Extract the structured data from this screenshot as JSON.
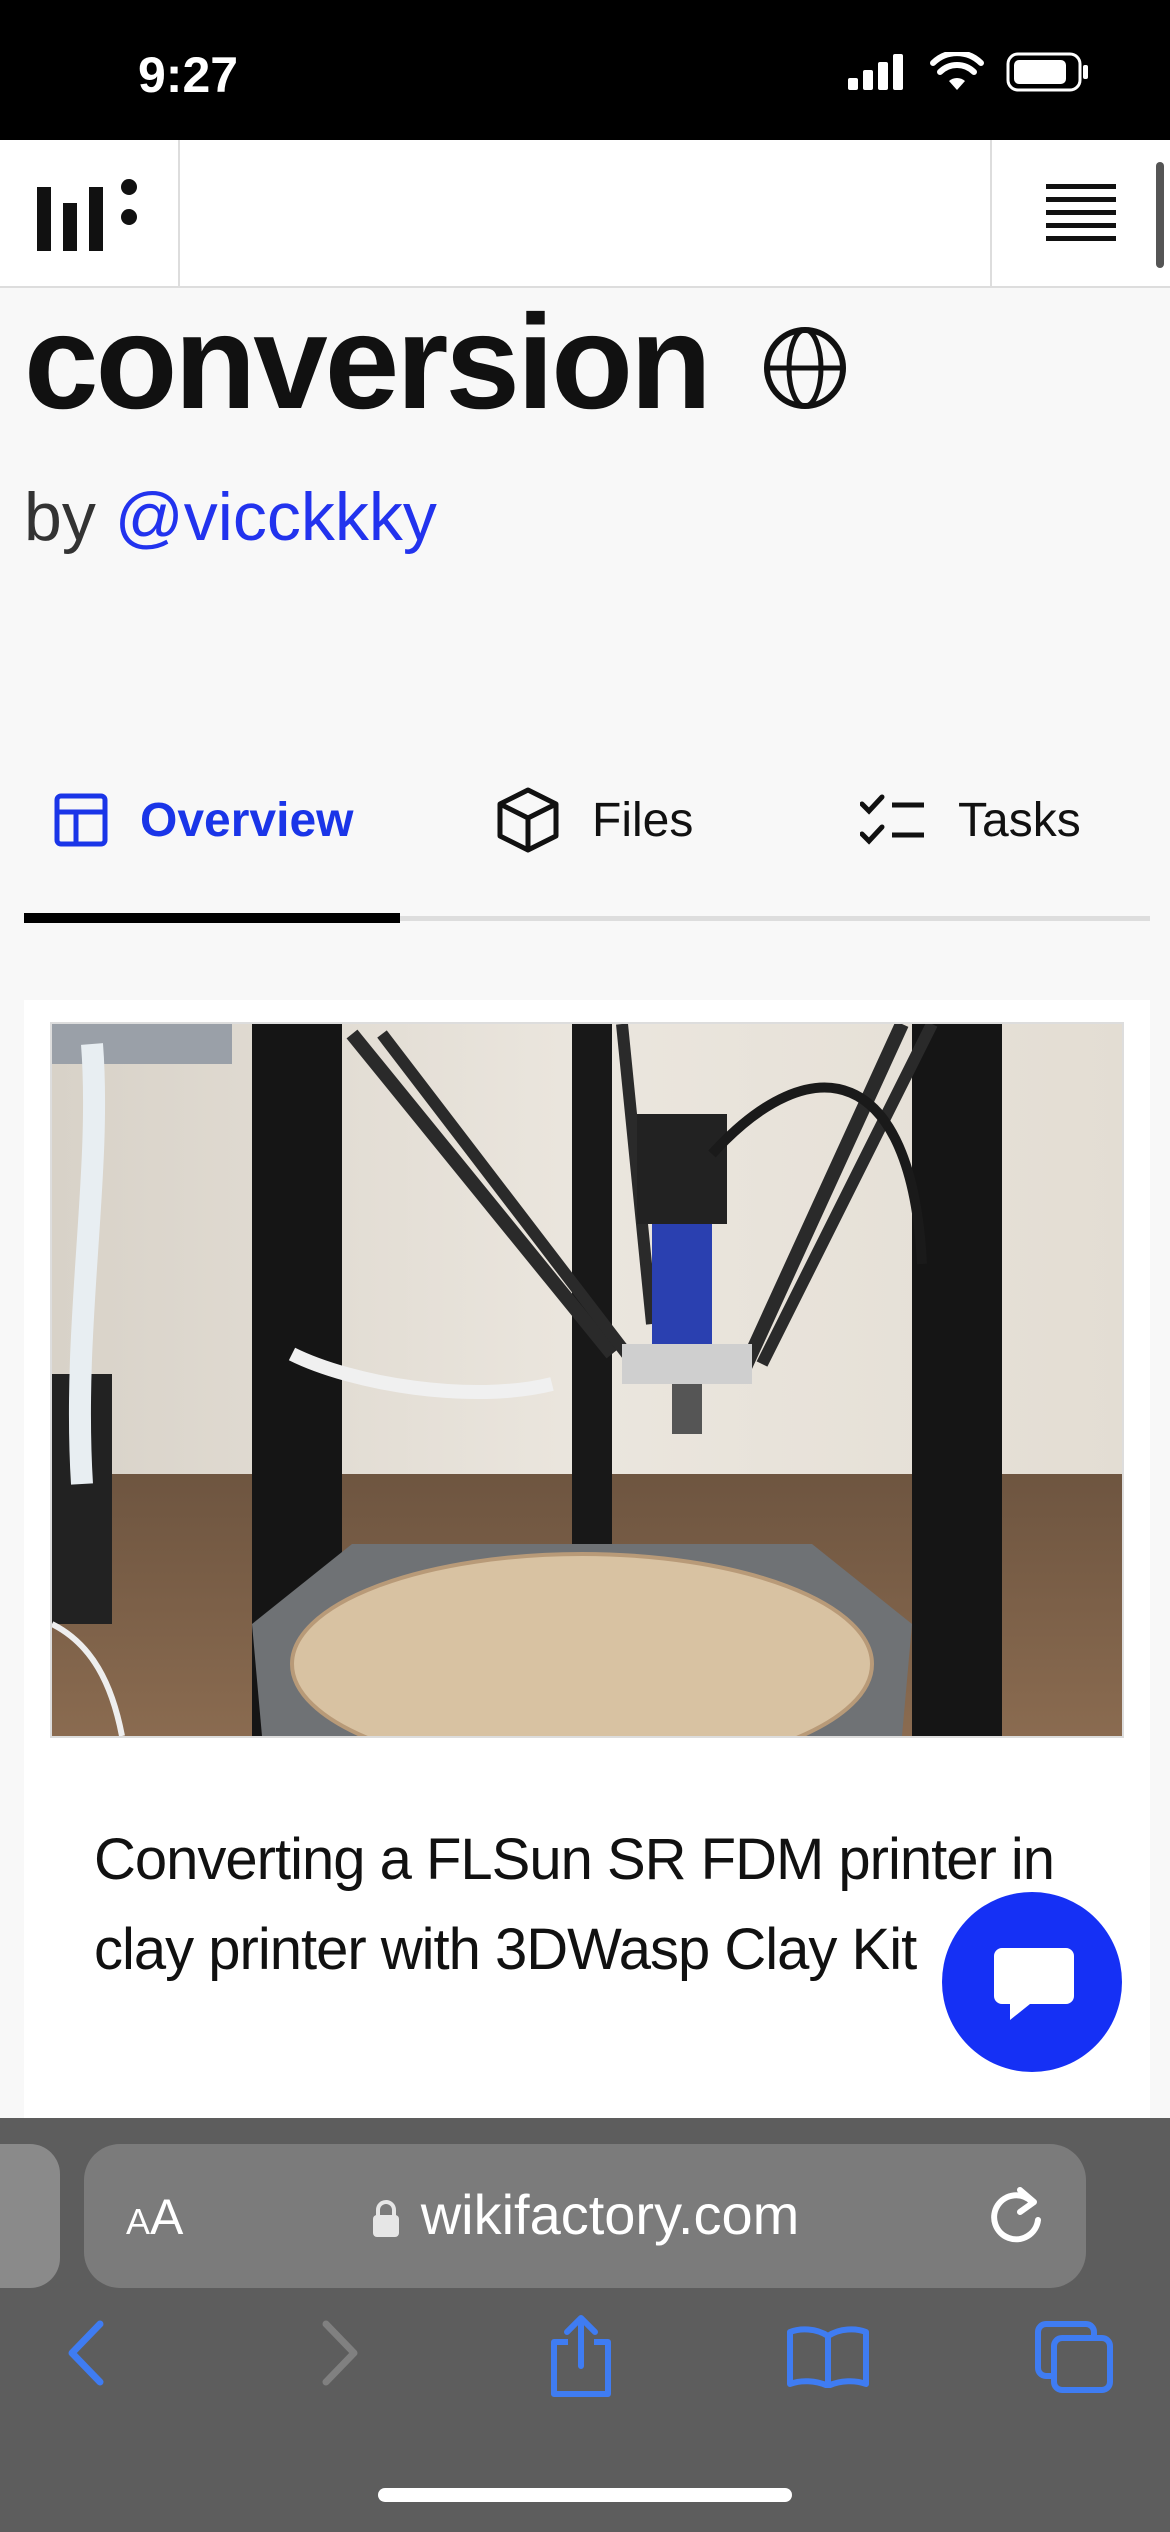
{
  "status_bar": {
    "time": "9:27"
  },
  "header": {
    "logo_icon": "wikifactory-logo",
    "menu_icon": "hamburger-menu-icon"
  },
  "project": {
    "title": "conversion",
    "by_label": "by",
    "author": "@vicckkky",
    "visibility_icon": "globe-icon"
  },
  "tabs": [
    {
      "label": "Overview",
      "icon": "layout-icon",
      "active": true
    },
    {
      "label": "Files",
      "icon": "cube-icon",
      "active": false
    },
    {
      "label": "Tasks",
      "icon": "checklist-icon",
      "active": false
    }
  ],
  "card": {
    "image_alt": "Delta 3D printer with clay extruder",
    "description": "Converting a FLSun SR FDM printer in clay printer with 3DWasp Clay Kit"
  },
  "browser": {
    "text_size_label_small": "A",
    "text_size_label_large": "A",
    "url": "wikifactory.com"
  },
  "colors": {
    "accent": "#1a35e8",
    "chat": "#1530f5",
    "safari_bar": "#5d5d5d"
  }
}
